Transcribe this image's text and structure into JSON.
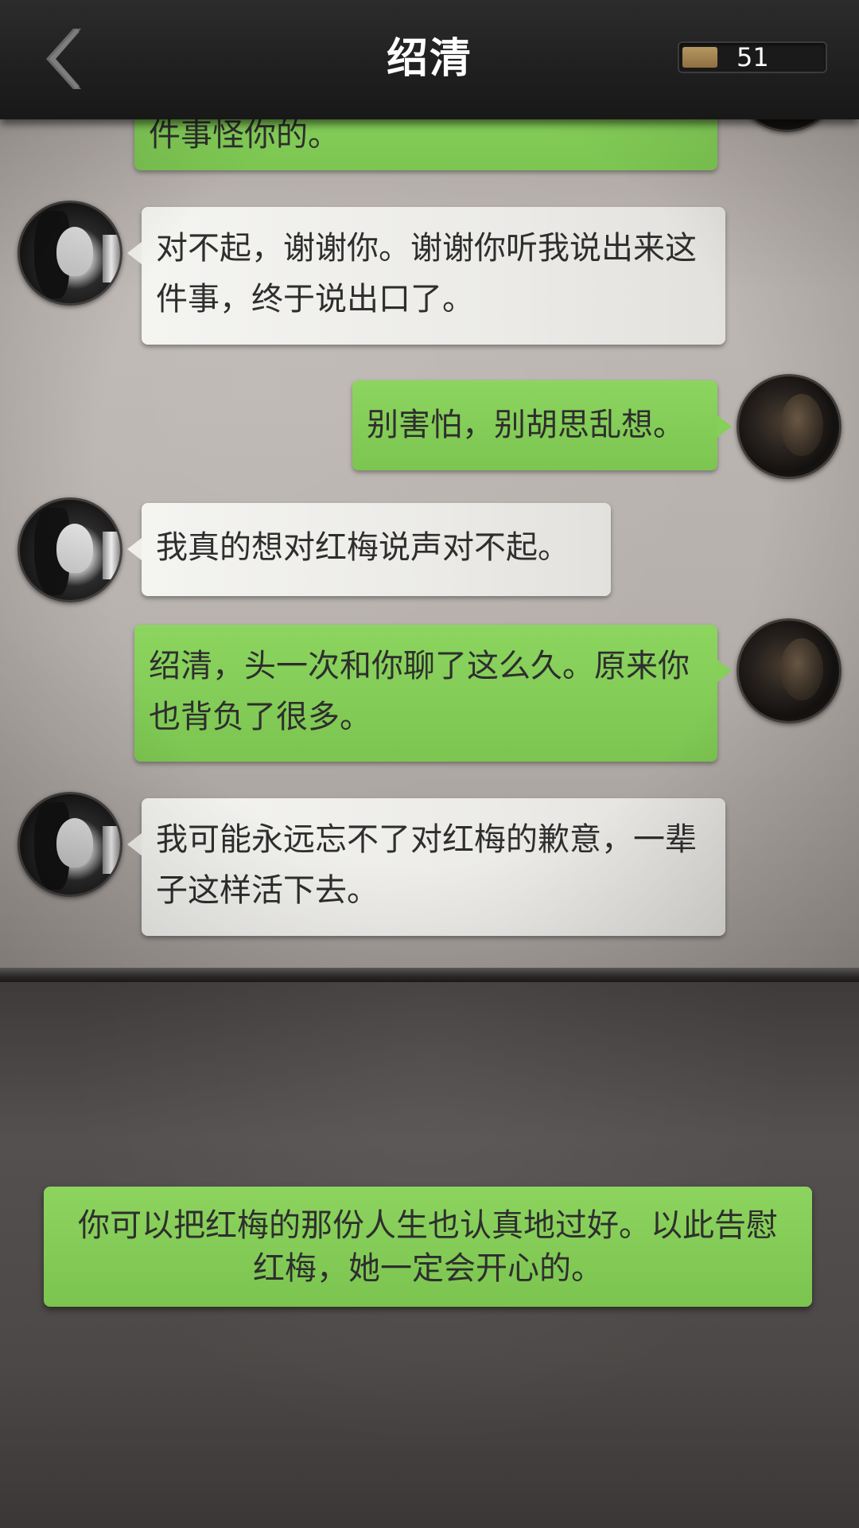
{
  "header": {
    "title": "绍清",
    "back_icon": "chevron-left-icon",
    "currency": {
      "icon": "coin-bar-icon",
      "value": "51"
    }
  },
  "chat": {
    "messages": [
      {
        "sender": "me",
        "text": "件事怪你的。"
      },
      {
        "sender": "her",
        "text": "对不起，谢谢你。谢谢你听我说出来这件事，终于说出口了。"
      },
      {
        "sender": "me",
        "text": "别害怕，别胡思乱想。"
      },
      {
        "sender": "her",
        "text": "我真的想对红梅说声对不起。"
      },
      {
        "sender": "me",
        "text": "绍清，头一次和你聊了这么久。原来你也背负了很多。"
      },
      {
        "sender": "her",
        "text": "我可能永远忘不了对红梅的歉意，一辈子这样活下去。"
      }
    ]
  },
  "reply_option": {
    "text": "你可以把红梅的那份人生也认真地过好。以此告慰红梅，她一定会开心的。"
  },
  "colors": {
    "green_bubble": "#86cf59",
    "white_bubble": "#efeeeb",
    "header_bg": "#222222",
    "title_text": "#ffffff"
  }
}
